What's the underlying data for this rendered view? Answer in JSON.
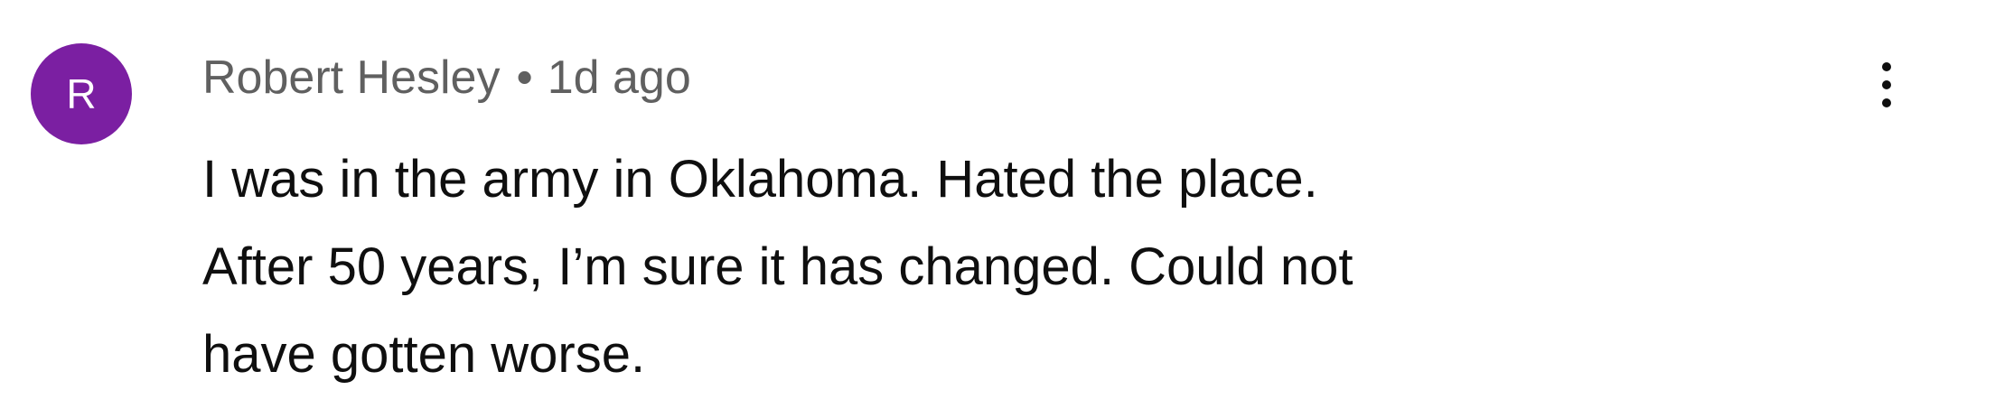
{
  "comment": {
    "avatar": {
      "letter": "R",
      "color": "#7B1FA2"
    },
    "author": "Robert Hesley",
    "separator": "•",
    "timestamp": "1d ago",
    "text_lines": [
      "I was in the army in Oklahoma. Hated the place.",
      "After 50 years, I’m sure it has changed. Could not",
      "have gotten worse."
    ],
    "menu_icon": "more-vertical-icon"
  }
}
